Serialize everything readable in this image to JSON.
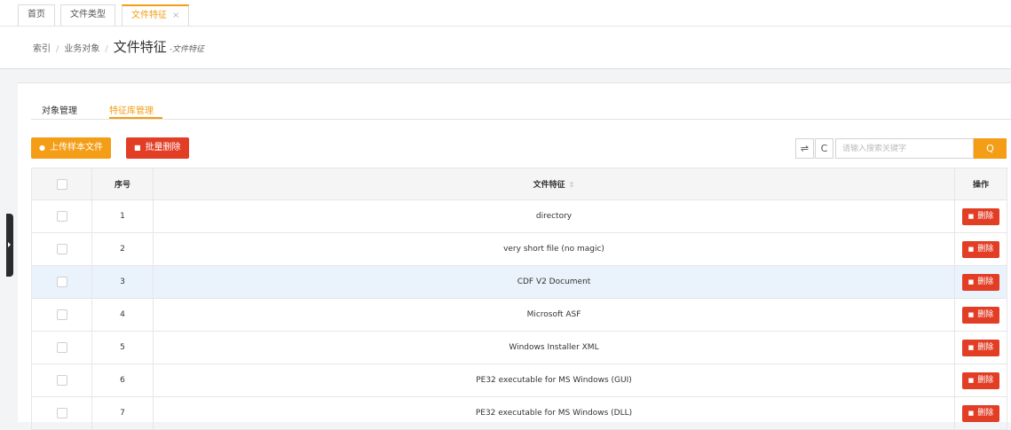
{
  "tabs": [
    {
      "label": "首页"
    },
    {
      "label": "文件类型"
    },
    {
      "label": "文件特征",
      "close": "×"
    }
  ],
  "breadcrumb": {
    "items": [
      "索引",
      "业务对象"
    ],
    "separator": "/",
    "title": "文件特征",
    "subtitle": "-文件特征"
  },
  "subtabs": [
    "对象管理",
    "特征库管理"
  ],
  "toolbar": {
    "upload_label": "上传样本文件",
    "batch_delete_label": "批量删除",
    "columns_icon": "⇌",
    "refresh_icon": "C",
    "search_placeholder": "请输入搜索关键字",
    "search_icon": "Q"
  },
  "table": {
    "headers": {
      "index": "序号",
      "feature": "文件特征",
      "sort_icon": "⇕",
      "action": "操作"
    },
    "delete_label": "删除",
    "rows": [
      {
        "index": "1",
        "feature": "directory"
      },
      {
        "index": "2",
        "feature": "very short file (no magic)"
      },
      {
        "index": "3",
        "feature": "CDF V2 Document"
      },
      {
        "index": "4",
        "feature": "Microsoft ASF"
      },
      {
        "index": "5",
        "feature": "Windows Installer XML"
      },
      {
        "index": "6",
        "feature": "PE32 executable for MS Windows (GUI)"
      },
      {
        "index": "7",
        "feature": "PE32 executable for MS Windows (DLL)"
      }
    ]
  },
  "colors": {
    "accent": "#f49d17",
    "danger": "#e23e26",
    "highlight_row": "#eaf3fb"
  }
}
